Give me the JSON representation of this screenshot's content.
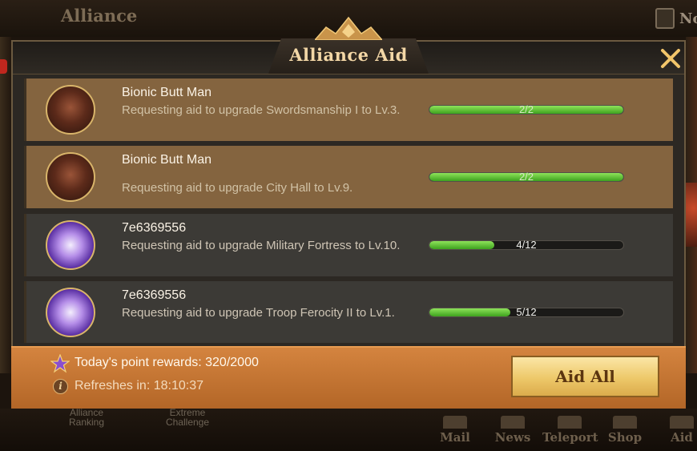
{
  "background": {
    "title": "Alliance",
    "top_right_label": "No",
    "nav": [
      {
        "label": "Mail"
      },
      {
        "label": "News"
      },
      {
        "label": "Teleport"
      },
      {
        "label": "Shop"
      },
      {
        "label": "Aid"
      }
    ],
    "sub_left": "Alliance\nRanking",
    "sub_mid": "Extreme\nChallenge"
  },
  "modal": {
    "title": "Alliance Aid",
    "close_icon": "close-x-icon"
  },
  "requests": [
    {
      "name": "Bionic Butt Man",
      "description": "Requesting aid to upgrade Swordsmanship I to Lv.3.",
      "progress_text": "2/2",
      "progress": 1.0,
      "style": "gold",
      "avatar": "man"
    },
    {
      "name": "Bionic Butt Man",
      "description": "Requesting aid to upgrade City Hall to Lv.9.",
      "progress_text": "2/2",
      "progress": 1.0,
      "style": "gold",
      "avatar": "man"
    },
    {
      "name": "7e6369556",
      "description": "Requesting aid to upgrade Military Fortress to Lv.10.",
      "progress_text": "4/12",
      "progress": 0.3333,
      "style": "dark",
      "avatar": "anime"
    },
    {
      "name": "7e6369556",
      "description": "Requesting aid to upgrade Troop Ferocity II to Lv.1.",
      "progress_text": "5/12",
      "progress": 0.4167,
      "style": "dark",
      "avatar": "anime"
    }
  ],
  "footer": {
    "points_text": "Today's point rewards: 320/2000",
    "refresh_text": "Refreshes in: 18:10:37",
    "aid_all_label": "Aid All",
    "star_icon": "purple-star-icon",
    "info_icon": "info-icon"
  },
  "colors": {
    "gold_row": "#84643f",
    "dark_row": "#3c3a36",
    "progress_green": "#5cc838",
    "footer_orange": "#c67433",
    "title": "#f3d7a6"
  }
}
